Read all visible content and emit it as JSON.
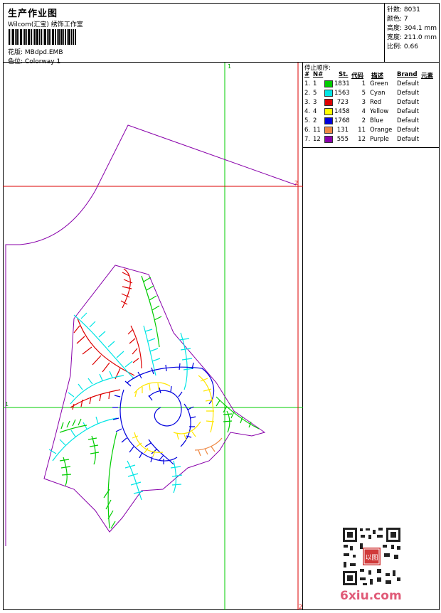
{
  "header": {
    "title": "生产作业图",
    "subtitle": "Wilcom(汇宝) 绣饰工作室",
    "file_label": "花版:",
    "file_name": "MBdpd.EMB",
    "colorway_label": "色位:",
    "colorway_name": "Colorway 1"
  },
  "info": {
    "stitches": "针数: 8031",
    "colors": "颜色: 7",
    "height": "高度: 304.1 mm",
    "width": "宽度: 211.0 mm",
    "scale": "比例: 0.66"
  },
  "stop_table": {
    "title": "停止顺序:",
    "headers": [
      "#",
      "N#",
      "St.",
      "代码",
      "描述",
      "Brand",
      "元素"
    ],
    "rows": [
      {
        "idx": "1.",
        "n": "1",
        "st": "1831",
        "code": "1",
        "desc": "Green",
        "brand": "Default",
        "color": "#00cc00"
      },
      {
        "idx": "2.",
        "n": "5",
        "st": "1563",
        "code": "5",
        "desc": "Cyan",
        "brand": "Default",
        "color": "#00e5e5"
      },
      {
        "idx": "3.",
        "n": "3",
        "st": "723",
        "code": "3",
        "desc": "Red",
        "brand": "Default",
        "color": "#dd0000"
      },
      {
        "idx": "4.",
        "n": "4",
        "st": "1458",
        "code": "4",
        "desc": "Yellow",
        "brand": "Default",
        "color": "#ffff00"
      },
      {
        "idx": "5.",
        "n": "2",
        "st": "1768",
        "code": "2",
        "desc": "Blue",
        "brand": "Default",
        "color": "#0000dd"
      },
      {
        "idx": "6.",
        "n": "11",
        "st": "131",
        "code": "11",
        "desc": "Orange",
        "brand": "Default",
        "color": "#ee8844"
      },
      {
        "idx": "7.",
        "n": "12",
        "st": "555",
        "code": "12",
        "desc": "Purple",
        "brand": "Default",
        "color": "#8800aa"
      }
    ]
  },
  "canvas": {
    "guide_label_1": "1",
    "guide_label_2": "2",
    "guide_label_3": "1",
    "guide_label_4": "2"
  },
  "watermark": {
    "site_name": "6xiu.com",
    "stamp_text": "以图"
  }
}
